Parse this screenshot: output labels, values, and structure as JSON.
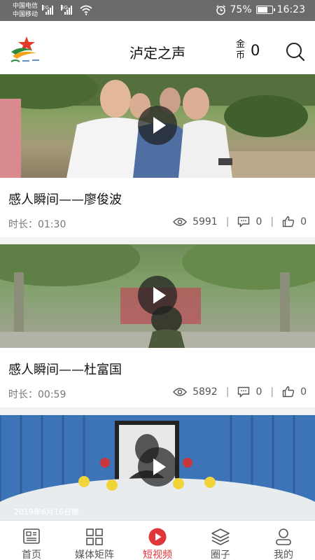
{
  "status_bar": {
    "carrier_1": "中国电信",
    "carrier_2": "中国移动",
    "net_1": "2G",
    "net_2": "4G",
    "battery_percent": "75%",
    "battery_level": 0.75,
    "time": "16:23"
  },
  "header": {
    "app_title": "泸定之声",
    "coin_label": "金币",
    "coin_value": "0"
  },
  "videos": [
    {
      "title": "感人瞬间——廖俊波",
      "duration": "时长：01:30",
      "views": "5991",
      "comments": "0",
      "likes": "0"
    },
    {
      "title": "感人瞬间——杜富国",
      "duration": "时长：00:59",
      "views": "5892",
      "comments": "0",
      "likes": "0"
    },
    {
      "date_stamp": "2019年6月16日晚"
    }
  ],
  "bottom_nav": [
    {
      "label": "首页",
      "icon": "home-icon"
    },
    {
      "label": "媒体矩阵",
      "icon": "grid-icon"
    },
    {
      "label": "短视频",
      "icon": "video-play-icon"
    },
    {
      "label": "圈子",
      "icon": "layers-icon"
    },
    {
      "label": "我的",
      "icon": "person-icon"
    }
  ],
  "colors": {
    "accent": "#e0353b",
    "status_bar": "#6b6b6b"
  }
}
